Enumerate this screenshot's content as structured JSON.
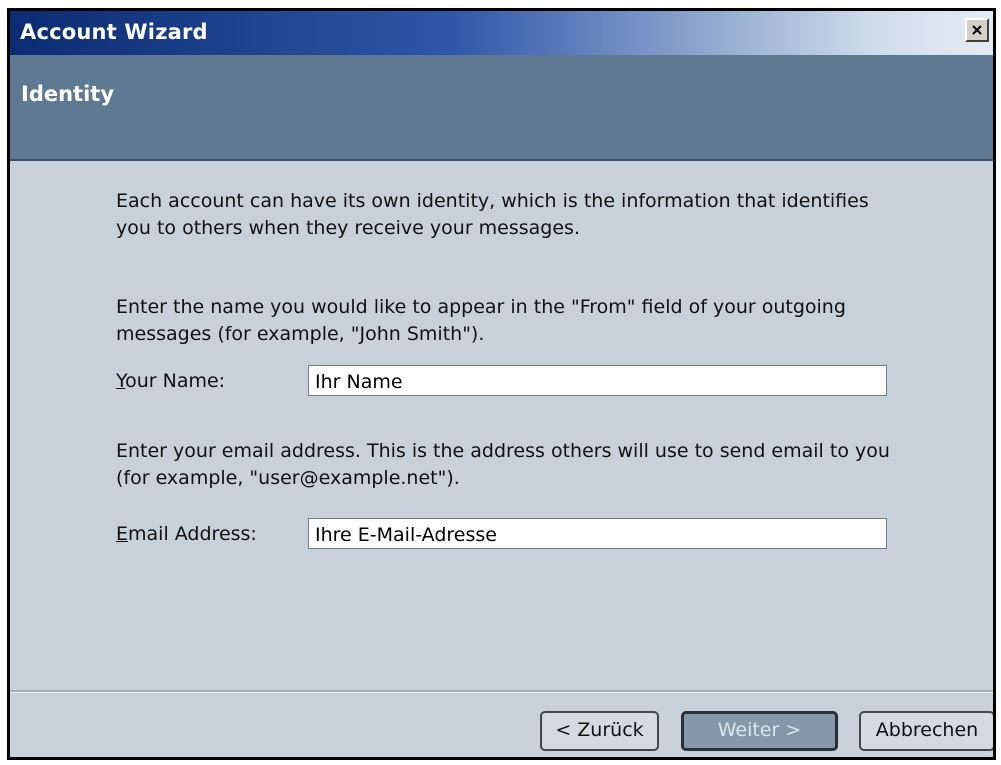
{
  "window": {
    "title": "Account Wizard",
    "close_icon": "close-icon"
  },
  "header": {
    "title": "Identity"
  },
  "content": {
    "intro": "Each account can have its own identity, which is the information that identifies you to others when they receive your messages.",
    "name_instructions": "Enter the name you would like to appear in the \"From\" field of your outgoing messages (for example, \"John Smith\").",
    "name_label_accesskey": "Y",
    "name_label_rest": "our Name:",
    "name_value": "Ihr Name",
    "email_instructions": "Enter your email address. This is the address others will use to send email to you (for example, \"user@example.net\").",
    "email_label_accesskey": "E",
    "email_label_rest": "mail Address:",
    "email_value": "Ihre E-Mail-Adresse"
  },
  "buttons": {
    "back": "< Zurück",
    "next": "Weiter >",
    "cancel": "Abbrechen"
  },
  "colors": {
    "title_gradient_start": "#0b2c72",
    "header_band": "#5f7992",
    "dialog_background": "#c8d0da"
  }
}
